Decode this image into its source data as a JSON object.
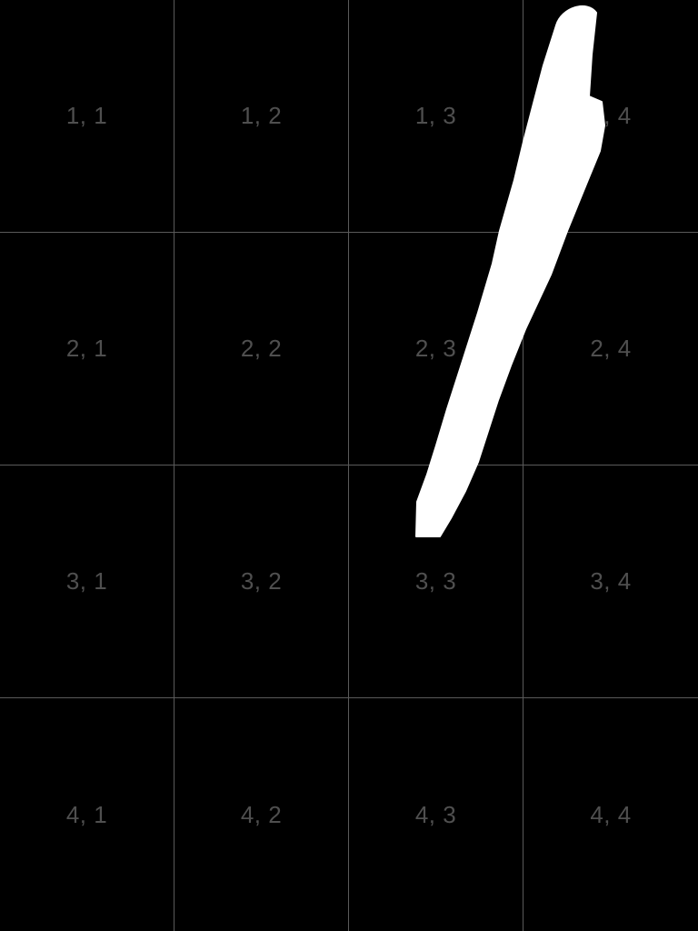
{
  "grid": {
    "rows": 4,
    "cols": 4,
    "cells": [
      [
        "1, 1",
        "1, 2",
        "1, 3",
        "1, 4"
      ],
      [
        "2, 1",
        "2, 2",
        "2, 3",
        "2, 4"
      ],
      [
        "3, 1",
        "3, 2",
        "3, 3",
        "3, 4"
      ],
      [
        "4, 1",
        "4, 2",
        "4, 3",
        "4, 4"
      ]
    ]
  },
  "colors": {
    "background": "#000000",
    "grid_line": "#5a5a5a",
    "label": "#4f4f4f",
    "stroke": "#ffffff"
  }
}
